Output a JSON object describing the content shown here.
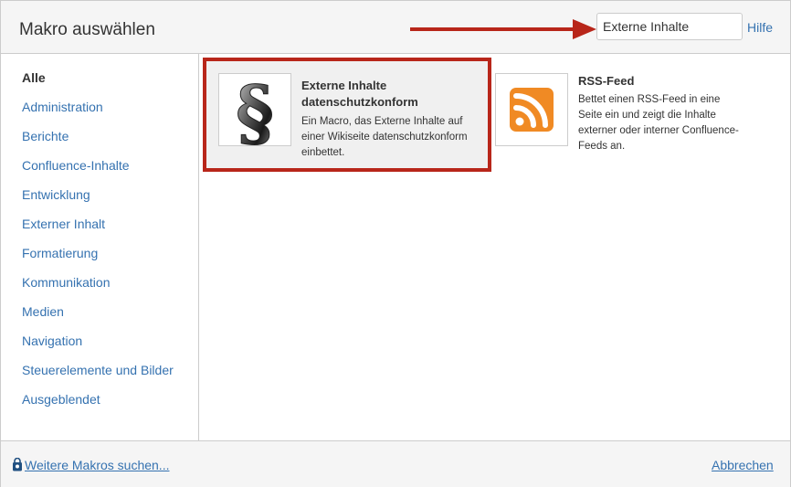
{
  "dialog": {
    "title": "Makro auswählen",
    "search_value": "Externe Inhalte",
    "help_label": "Hilfe"
  },
  "sidebar": {
    "items": [
      {
        "label": "Alle",
        "active": true
      },
      {
        "label": "Administration"
      },
      {
        "label": "Berichte"
      },
      {
        "label": "Confluence-Inhalte"
      },
      {
        "label": "Entwicklung"
      },
      {
        "label": "Externer Inhalt"
      },
      {
        "label": "Formatierung"
      },
      {
        "label": "Kommunikation"
      },
      {
        "label": "Medien"
      },
      {
        "label": "Navigation"
      },
      {
        "label": "Steuerelemente und Bilder"
      },
      {
        "label": "Ausgeblendet"
      }
    ]
  },
  "macros": [
    {
      "title": "Externe Inhalte datenschutzkonform",
      "description": "Ein Macro, das Externe Inhalte auf einer Wikiseite datenschutzkonform einbettet.",
      "icon": "paragraph-icon"
    },
    {
      "title": "RSS-Feed",
      "description": "Bettet einen RSS-Feed in eine Seite ein und zeigt die Inhalte externer oder interner Confluence-Feeds an.",
      "icon": "rss-icon"
    }
  ],
  "footer": {
    "more_label": "Weitere Makros suchen...",
    "cancel_label": "Abbrechen"
  },
  "colors": {
    "link": "#3572b0",
    "highlight": "#b8261a",
    "rss": "#f08a24"
  }
}
